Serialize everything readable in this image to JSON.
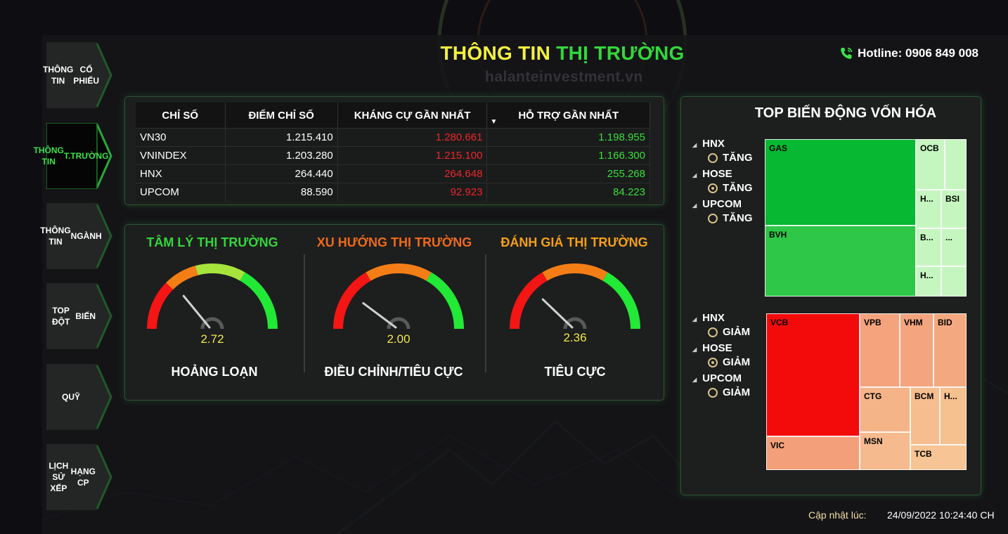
{
  "sidebar": {
    "items": [
      {
        "label_1": "THÔNG TIN",
        "label_2": "CỔ PHIẾU"
      },
      {
        "label_1": "THÔNG TIN",
        "label_2": "T.TRƯỜNG"
      },
      {
        "label_1": "THÔNG TIN",
        "label_2": "NGÀNH"
      },
      {
        "label_1": "TOP ĐỘT",
        "label_2": "BIẾN"
      },
      {
        "label_1": "QUỸ",
        "label_2": ""
      },
      {
        "label_1": "LỊCH SỬ XẾP",
        "label_2": "HẠNG CP"
      }
    ],
    "active_index": 1
  },
  "header": {
    "title_part1": "THÔNG TIN",
    "title_part2": "THỊ TRƯỜNG",
    "watermark": "halanteinvestment.vn",
    "hotline_label": "Hotline: 0906 849 008"
  },
  "index_table": {
    "headers": [
      "CHỈ SỐ",
      "ĐIỂM CHỈ SỐ",
      "KHÁNG CỰ GẦN NHẤT",
      "HỖ TRỢ GẦN NHẤT"
    ],
    "rows": [
      {
        "name": "VN30",
        "points": "1.215.410",
        "resistance": "1.280.661",
        "support": "1.198.955"
      },
      {
        "name": "VNINDEX",
        "points": "1.203.280",
        "resistance": "1.215.100",
        "support": "1.166.300"
      },
      {
        "name": "HNX",
        "points": "264.440",
        "resistance": "264.648",
        "support": "255.268"
      },
      {
        "name": "UPCOM",
        "points": "88.590",
        "resistance": "92.923",
        "support": "84.223"
      }
    ]
  },
  "gauges": [
    {
      "title": "TÂM LÝ THỊ TRƯỜNG",
      "title_color": "#34d63c",
      "value": "2.72",
      "level": 0.272,
      "label": "HOẢNG LOẠN"
    },
    {
      "title": "XU HƯỚNG THỊ TRƯỜNG",
      "title_color": "#ee6a1c",
      "value": "2.00",
      "level": 0.2,
      "label": "ĐIỀU CHỈNH/TIÊU CỰC"
    },
    {
      "title": "ĐÁNH GIÁ THỊ TRƯỜNG",
      "title_color": "#f4a017",
      "value": "2.36",
      "level": 0.236,
      "label": "TIÊU CỰC"
    }
  ],
  "treemap_panel": {
    "title": "TOP BIẾN ĐỘNG VỐN HÓA",
    "up_filters": [
      {
        "exchange": "HNX",
        "option": "TĂNG",
        "selected": false
      },
      {
        "exchange": "HOSE",
        "option": "TĂNG",
        "selected": true
      },
      {
        "exchange": "UPCOM",
        "option": "TĂNG",
        "selected": false
      }
    ],
    "down_filters": [
      {
        "exchange": "HNX",
        "option": "GIẢM",
        "selected": false
      },
      {
        "exchange": "HOSE",
        "option": "GIẢM",
        "selected": true
      },
      {
        "exchange": "UPCOM",
        "option": "GIẢM",
        "selected": false
      }
    ],
    "up_tiles": [
      {
        "label": "GAS",
        "color": "#06b832"
      },
      {
        "label": "BVH",
        "color": "#2ec747"
      },
      {
        "label": "OCB",
        "color": "#c6f6c0"
      },
      {
        "label": "",
        "color": "#c6f6c0"
      },
      {
        "label": "H...",
        "color": "#c6f6c0"
      },
      {
        "label": "BSI",
        "color": "#c6f6c0"
      },
      {
        "label": "B...",
        "color": "#c6f6c0"
      },
      {
        "label": "...",
        "color": "#c6f6c0"
      },
      {
        "label": "H...",
        "color": "#c6f6c0"
      },
      {
        "label": "",
        "color": "#c6f6c0"
      }
    ],
    "down_tiles": [
      {
        "label": "VCB",
        "color": "#f30a0a"
      },
      {
        "label": "VIC",
        "color": "#f3a07a"
      },
      {
        "label": "VPB",
        "color": "#f4a37c"
      },
      {
        "label": "VHM",
        "color": "#f4a47e"
      },
      {
        "label": "BID",
        "color": "#f4a87f"
      },
      {
        "label": "CTG",
        "color": "#f5b487"
      },
      {
        "label": "MSN",
        "color": "#f5ba8e"
      },
      {
        "label": "BCM",
        "color": "#f6bd8e"
      },
      {
        "label": "H...",
        "color": "#f6c08f"
      },
      {
        "label": "TCB",
        "color": "#f6c495"
      }
    ]
  },
  "footer": {
    "updated_label": "Cập nhật lúc:",
    "updated_value": "24/09/2022 10:24:40 CH"
  },
  "colors": {
    "accent_green": "#34d63c",
    "title_yellow": "#f4f040",
    "negative": "#f0262a",
    "positive": "#39df3b"
  }
}
